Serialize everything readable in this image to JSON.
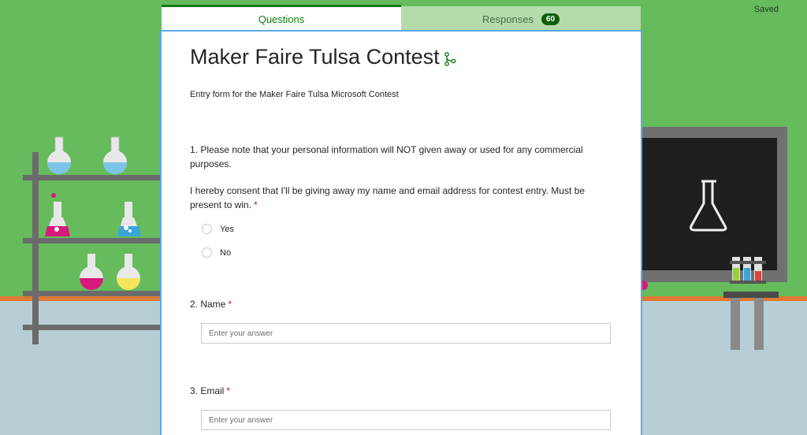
{
  "status": {
    "saved": "Saved"
  },
  "tabs": {
    "questions": "Questions",
    "responses": "Responses",
    "responses_count": "60"
  },
  "form": {
    "title": "Maker Faire Tulsa Contest",
    "description": "Entry form for the Maker Faire Tulsa Microsoft Contest"
  },
  "questions": {
    "q1_text": "1. Please note that your personal information will NOT given away or used for any commercial purposes.",
    "q1_consent": "I hereby consent that I'll be giving away my name and email address for contest entry.  Must be present to win.",
    "q1_required": "*",
    "q1_options": [
      "Yes",
      "No"
    ],
    "q2_text": "2. Name",
    "q2_required": "*",
    "q2_placeholder": "Enter your answer",
    "q3_text": "3. Email",
    "q3_required": "*",
    "q3_placeholder": "Enter your answer"
  },
  "colors": {
    "accent": "#107c10",
    "wall": "#66bb5c",
    "floor": "#b7cfd4",
    "required": "#c50f1f"
  },
  "icons": {
    "title_icon": "branching-icon"
  }
}
